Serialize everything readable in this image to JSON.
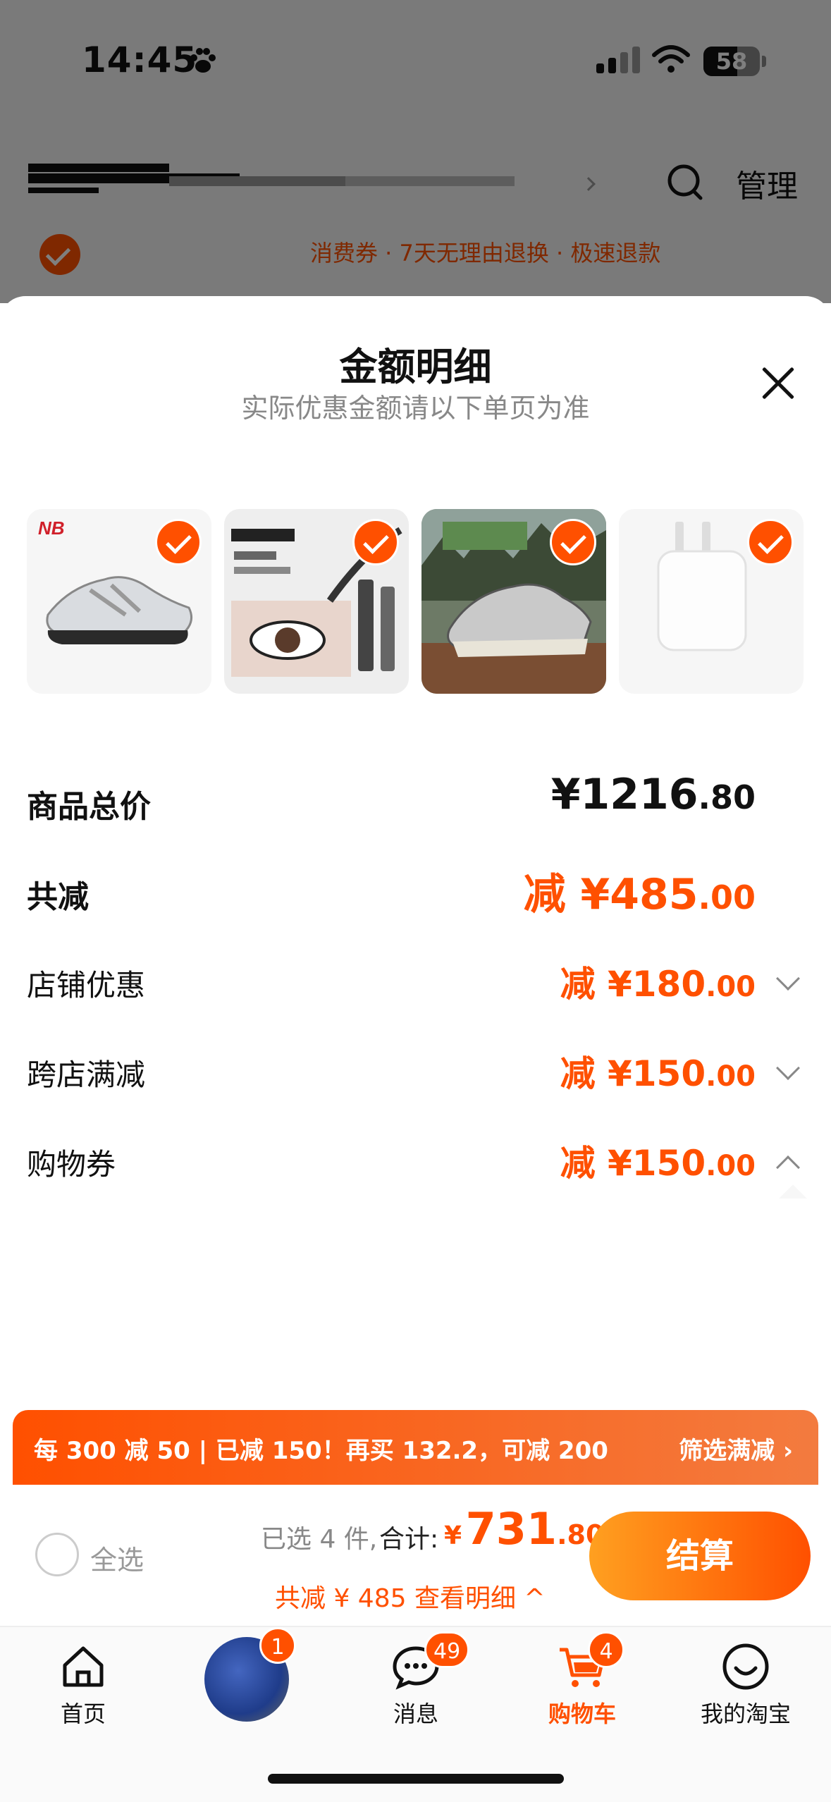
{
  "status_bar": {
    "time": "14:45",
    "battery": "58"
  },
  "background": {
    "manage_label": "管理",
    "promo_text": "消费券 · 7天无理由退换 · 极速退款"
  },
  "sheet": {
    "title": "金额明细",
    "subtitle": "实际优惠金额请以下单页为准",
    "products": [
      {
        "name": "new-balance-shoe-white"
      },
      {
        "name": "mascara"
      },
      {
        "name": "new-balance-shoe-outdoor"
      },
      {
        "name": "power-adapter"
      }
    ],
    "rows": {
      "total": {
        "label": "商品总价",
        "main": "¥1216",
        "dec": ".80"
      },
      "reduce": {
        "label": "共减",
        "main": "减 ¥485",
        "dec": ".00"
      },
      "shop": {
        "label": "店铺优惠",
        "main": "减 ¥180",
        "dec": ".00"
      },
      "cross": {
        "label": "跨店满减",
        "main": "减 ¥150",
        "dec": ".00"
      },
      "coupon": {
        "label": "购物券",
        "main": "减 ¥150",
        "dec": ".00"
      }
    }
  },
  "banner": {
    "text": "每 300 减 50 | 已减 150！再买 132.2，可减 200",
    "action": "筛选满减 ›"
  },
  "checkout": {
    "select_all": "全选",
    "selected": "已选 4 件,",
    "total_label": "合计:",
    "currency": "¥",
    "total_int": "731",
    "total_dec": ".80",
    "saved": "共减 ¥ 485  查看明细 ^",
    "button": "结算"
  },
  "tabbar": {
    "tabs": [
      {
        "label": "首页",
        "icon": "home-icon"
      },
      {
        "label": "",
        "icon": "avatar",
        "badge": "1"
      },
      {
        "label": "消息",
        "icon": "message-icon",
        "badge": "49"
      },
      {
        "label": "购物车",
        "icon": "cart-icon",
        "badge": "4"
      },
      {
        "label": "我的淘宝",
        "icon": "profile-icon"
      }
    ]
  },
  "colors": {
    "accent": "#ff5000"
  }
}
